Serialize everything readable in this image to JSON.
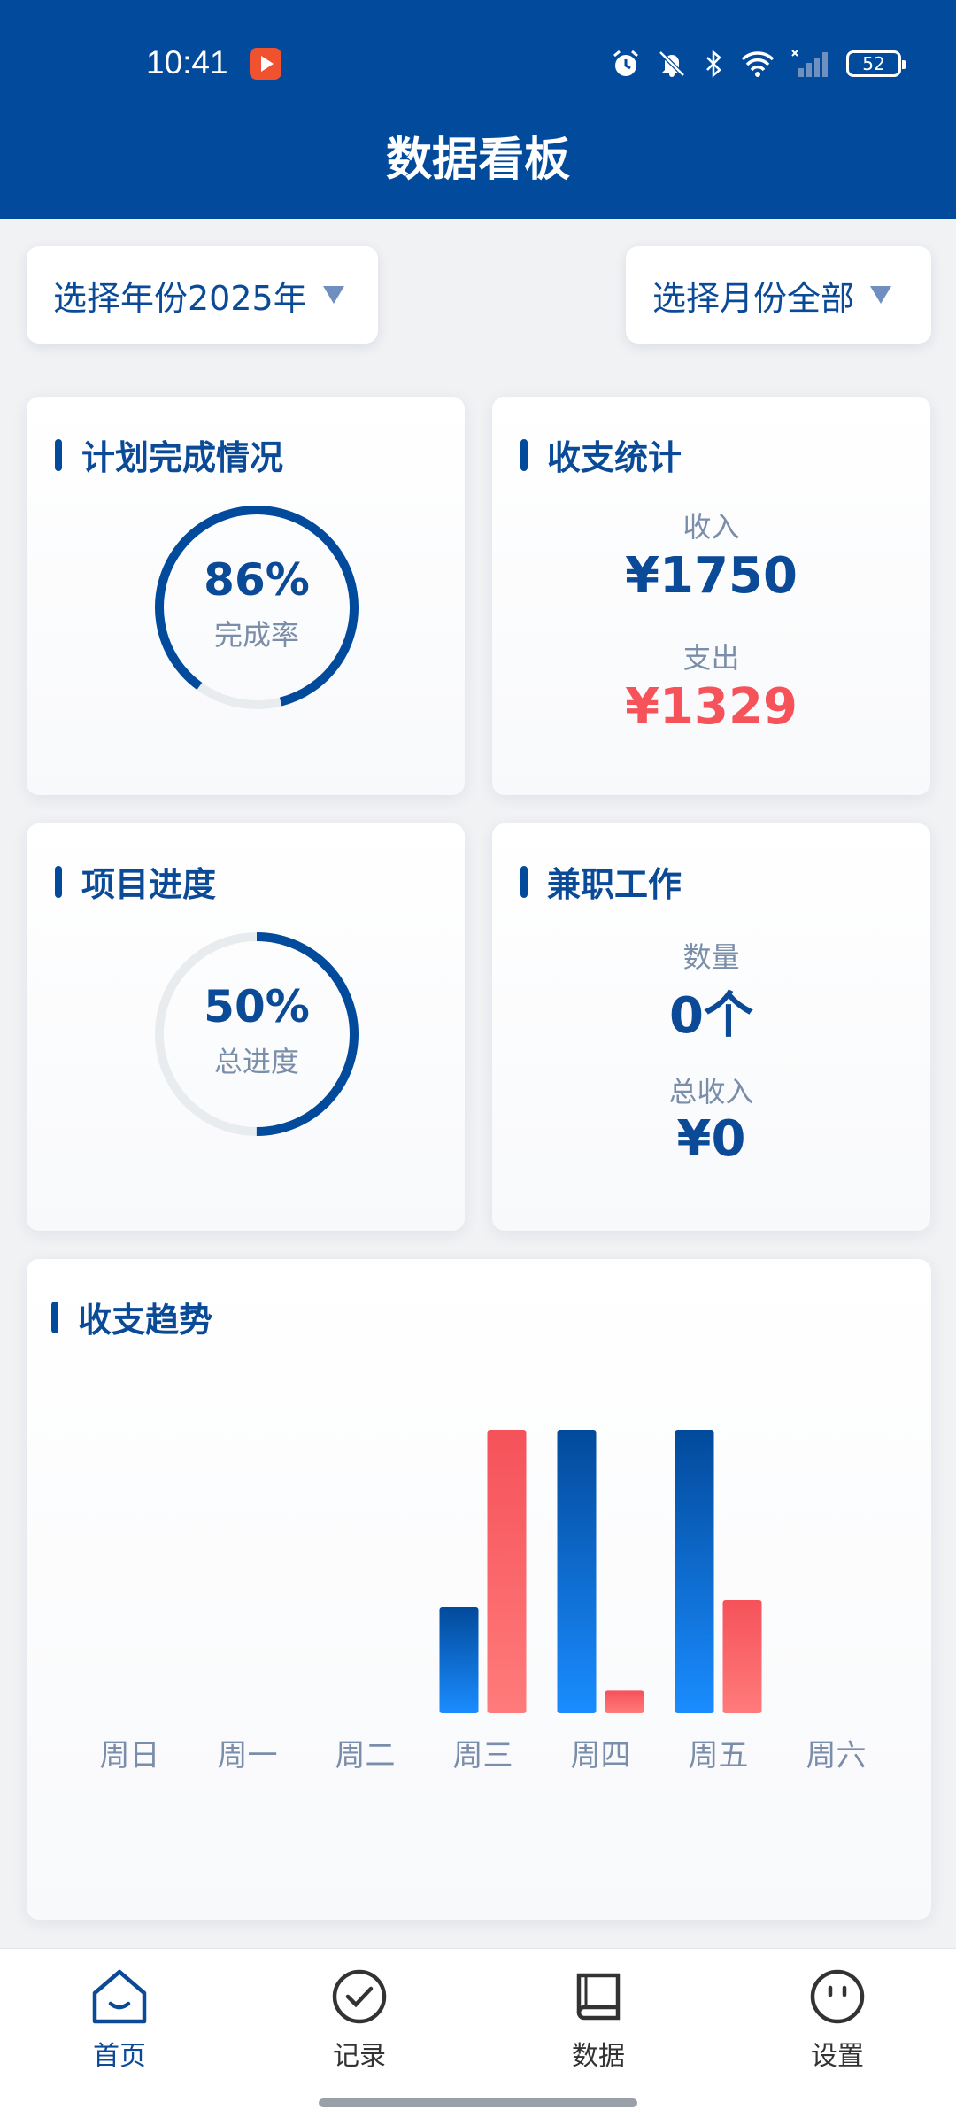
{
  "status_bar": {
    "time": "10:41",
    "battery": "52"
  },
  "header": {
    "title": "数据看板"
  },
  "filters": {
    "year_label": "选择年份2025年",
    "month_label": "选择月份全部"
  },
  "plan_card": {
    "title": "计划完成情况",
    "value": "86%",
    "label": "完成率",
    "progress": 0.86
  },
  "finance_card": {
    "title": "收支统计",
    "income_label": "收入",
    "income_value": "¥1750",
    "expense_label": "支出",
    "expense_value": "¥1329"
  },
  "project_card": {
    "title": "项目进度",
    "value": "50%",
    "label": "总进度",
    "progress": 0.5
  },
  "parttime_card": {
    "title": "兼职工作",
    "count_label": "数量",
    "count_value": "0个",
    "income_label": "总收入",
    "income_value": "¥0"
  },
  "trend_card": {
    "title": "收支趋势"
  },
  "chart_data": {
    "type": "bar",
    "categories": [
      "周日",
      "周一",
      "周二",
      "周三",
      "周四",
      "周五",
      "周六"
    ],
    "series": [
      {
        "values": [
          0,
          0,
          0,
          375,
          1000,
          1000,
          0
        ],
        "color": "#0a57b3"
      },
      {
        "values": [
          0,
          0,
          0,
          1000,
          80,
          400,
          0
        ],
        "color": "#f5525a"
      }
    ],
    "ylim": [
      0,
      1000
    ]
  },
  "bottom_nav": {
    "items": [
      {
        "label": "首页",
        "icon": "home-icon",
        "active": true
      },
      {
        "label": "记录",
        "icon": "check-circle-icon"
      },
      {
        "label": "数据",
        "icon": "book-icon"
      },
      {
        "label": "设置",
        "icon": "smiley-icon"
      }
    ]
  },
  "colors": {
    "primary": "#024a9b",
    "expense": "#f5525a",
    "muted": "#7a8ea9"
  }
}
